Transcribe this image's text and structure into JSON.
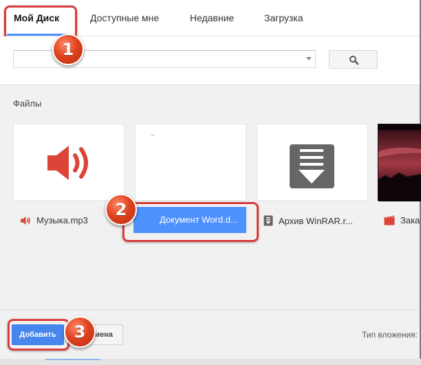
{
  "tabs": [
    {
      "label": "Мой Диск",
      "active": true
    },
    {
      "label": "Доступные мне",
      "active": false
    },
    {
      "label": "Недавние",
      "active": false
    },
    {
      "label": "Загрузка",
      "active": false
    }
  ],
  "search": {
    "value": "",
    "placeholder": ""
  },
  "files_section_title": "Файлы",
  "files": [
    {
      "name": "Музыка.mp3",
      "icon": "speaker-icon",
      "color": "#db4437"
    },
    {
      "name": "Документ Word.d...",
      "icon": "word-doc-icon",
      "color": "#4d90fe",
      "selected": true,
      "thumb_text": "™"
    },
    {
      "name": "Архив WinRAR.r...",
      "icon": "archive-icon",
      "color": "#666666"
    },
    {
      "name": "Зака",
      "icon": "video-icon",
      "color": "#db4437"
    }
  ],
  "footer": {
    "add_label": "Добавить",
    "cancel_label": "мена",
    "attach_type_label": "Тип вложения:"
  },
  "markers": [
    "1",
    "2",
    "3"
  ],
  "colors": {
    "accent": "#4d90fe",
    "highlight": "#d83b3b",
    "marker": "#e0441f"
  }
}
